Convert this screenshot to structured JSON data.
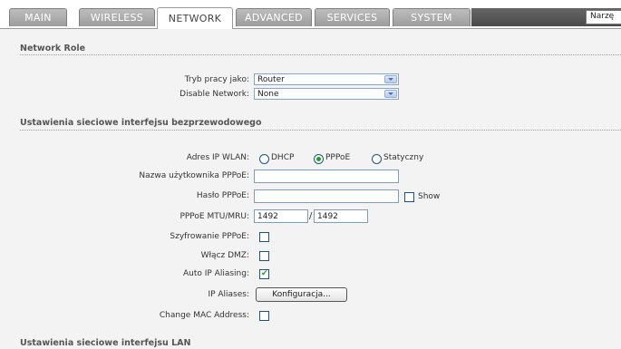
{
  "nav": {
    "tabs": [
      "MAIN",
      "WIRELESS",
      "NETWORK",
      "ADVANCED",
      "SERVICES",
      "SYSTEM"
    ],
    "active_tab": "NETWORK",
    "tools_select_value": "Narzę"
  },
  "network_role": {
    "title": "Network Role",
    "mode_label": "Tryb pracy jako:",
    "mode_value": "Router",
    "disable_network_label": "Disable Network:",
    "disable_network_value": "None"
  },
  "wireless": {
    "title": "Ustawienia sieciowe interfejsu bezprzewodowego",
    "ip_label": "Adres IP WLAN:",
    "ip_options": [
      "DHCP",
      "PPPoE",
      "Statyczny"
    ],
    "ip_selected": "PPPoE",
    "pppoe_user_label": "Nazwa użytkownika PPPoE:",
    "pppoe_user_value": "",
    "pppoe_pass_label": "Hasło PPPoE:",
    "pppoe_pass_value": "",
    "show_label": "Show",
    "show_checked": false,
    "mtu_label": "PPPoE MTU/MRU:",
    "mtu_value": "1492",
    "mru_value": "1492",
    "encryption_label": "Szyfrowanie PPPoE:",
    "encryption_checked": false,
    "dmz_label": "Włącz DMZ:",
    "dmz_checked": false,
    "auto_alias_label": "Auto IP Aliasing:",
    "auto_alias_checked": true,
    "ip_aliases_label": "IP Aliases:",
    "configure_button": "Konfiguracja...",
    "change_mac_label": "Change MAC Address:",
    "change_mac_checked": false
  },
  "lan": {
    "title": "Ustawienia sieciowe interfejsu LAN"
  },
  "colors": {
    "tab_bar": "#9d9d9d",
    "accent_check": "#21a121",
    "panel_bg": "#f3f3f3"
  }
}
